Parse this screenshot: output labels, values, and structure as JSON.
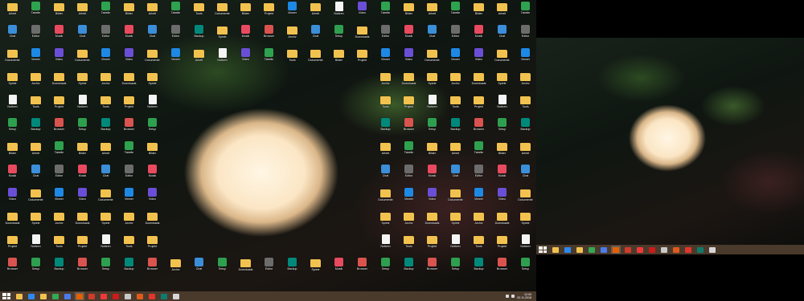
{
  "taskbar": {
    "start_label": "Start",
    "pinned": [
      {
        "name": "start",
        "label": "",
        "color": "#ffffff"
      },
      {
        "name": "file-explorer",
        "label": "",
        "color": "#f2c24f"
      },
      {
        "name": "internet-explorer",
        "label": "",
        "color": "#2d89ef"
      },
      {
        "name": "file-explorer-2",
        "label": "",
        "color": "#f2c24f"
      },
      {
        "name": "spreadsheet",
        "label": "",
        "color": "#34a853"
      },
      {
        "name": "email",
        "label": "",
        "color": "#4b7bec"
      },
      {
        "name": "firefox",
        "label": "",
        "color": "#e66000"
      },
      {
        "name": "browser",
        "label": "",
        "color": "#d23a2a"
      },
      {
        "name": "vivaldi",
        "label": "",
        "color": "#ef3939"
      },
      {
        "name": "opera",
        "label": "",
        "color": "#cc1b1b"
      },
      {
        "name": "calendar",
        "label": "",
        "color": "#c8c8c8"
      },
      {
        "name": "red-app",
        "label": "",
        "color": "#e05a1b"
      },
      {
        "name": "text-app",
        "label": "",
        "color": "#e3352c"
      },
      {
        "name": "publisher",
        "label": "",
        "color": "#0f7b6c"
      },
      {
        "name": "other",
        "label": "",
        "color": "#d7d7d7"
      }
    ],
    "clock_time": "12:00",
    "clock_date": "02.11.2018"
  },
  "right_taskbar": {
    "pinned": [
      {
        "name": "start",
        "color": "#ffffff"
      },
      {
        "name": "file-explorer",
        "color": "#f2c24f"
      },
      {
        "name": "internet-explorer",
        "color": "#2d89ef"
      },
      {
        "name": "file-explorer-2",
        "color": "#f2c24f"
      },
      {
        "name": "spreadsheet",
        "color": "#34a853"
      },
      {
        "name": "email",
        "color": "#4b7bec"
      },
      {
        "name": "firefox",
        "color": "#e66000"
      },
      {
        "name": "browser",
        "color": "#d23a2a"
      },
      {
        "name": "vivaldi",
        "color": "#ef3939"
      },
      {
        "name": "opera",
        "color": "#cc1b1b"
      },
      {
        "name": "calendar",
        "color": "#c8c8c8"
      },
      {
        "name": "red-app",
        "color": "#e05a1b"
      },
      {
        "name": "text-app",
        "color": "#e3352c"
      },
      {
        "name": "publisher",
        "color": "#0f7b6c"
      },
      {
        "name": "other",
        "color": "#d7d7d7"
      }
    ]
  },
  "desktop_icons": [
    {
      "label": "Arbeit",
      "kind": "folder",
      "color": "#f2c24f"
    },
    {
      "label": "Chat",
      "kind": "app",
      "color": "#3b8ed8"
    },
    {
      "label": "Dokumente",
      "kind": "folder",
      "color": "#f2c24f"
    },
    {
      "label": "Spiele",
      "kind": "folder",
      "color": "#f2c24f"
    },
    {
      "label": "Notizen",
      "kind": "doc",
      "color": "#f5f5f5"
    },
    {
      "label": "Setup",
      "kind": "app",
      "color": "#2e9f4f"
    },
    {
      "label": "Bilder",
      "kind": "folder",
      "color": "#f2c24f"
    },
    {
      "label": "Musik",
      "kind": "app",
      "color": "#e84a5f"
    },
    {
      "label": "Video",
      "kind": "app",
      "color": "#6a4fd6"
    },
    {
      "label": "Downloads",
      "kind": "folder",
      "color": "#f2c24f"
    },
    {
      "label": "Projekt",
      "kind": "folder",
      "color": "#f2c24f"
    },
    {
      "label": "Browser",
      "kind": "app",
      "color": "#d9534f"
    },
    {
      "label": "Tabelle",
      "kind": "app",
      "color": "#2fa24f"
    },
    {
      "label": "Editor",
      "kind": "app",
      "color": "#6c6c6c"
    },
    {
      "label": "Viewer",
      "kind": "app",
      "color": "#1e88e5"
    },
    {
      "label": "Archiv",
      "kind": "folder",
      "color": "#f2c24f"
    },
    {
      "label": "Tools",
      "kind": "folder",
      "color": "#f2c24f"
    },
    {
      "label": "Backup",
      "kind": "app",
      "color": "#00897b"
    }
  ]
}
